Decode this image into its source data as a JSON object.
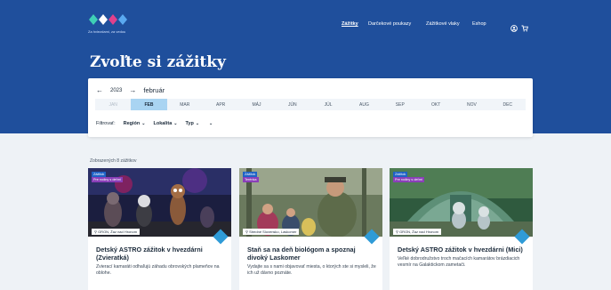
{
  "brand": {
    "tagline": "Za hviezdami, za vedou",
    "colors": {
      "dark_blue": "#1f4f9c",
      "diamond_blue": "#2f9bd7",
      "tag_blue": "#1f63c6",
      "tag_purple": "#8a3fb8",
      "selected_month": "#a9d4f2"
    }
  },
  "nav": {
    "items": [
      "Zážitky",
      "Darčekové poukazy",
      "Zážitkové vlaky",
      "Eshop"
    ],
    "active": "Zážitky",
    "icons": [
      "user-icon",
      "cart-icon"
    ]
  },
  "page": {
    "title": "Zvoľte si zážitky"
  },
  "filters": {
    "prev_arrow": "←",
    "year": "2023",
    "next_arrow": "→",
    "month_label": "február",
    "months": [
      "JAN",
      "FEB",
      "MAR",
      "APR",
      "MÁJ",
      "JÚN",
      "JÚL",
      "AUG",
      "SEP",
      "OKT",
      "NOV",
      "DEC"
    ],
    "selected_month": "FEB",
    "muted_months": [
      "JAN"
    ],
    "filter_label": "Filtrovať:",
    "dropdowns": [
      "Región",
      "Lokalita",
      "Typ",
      ""
    ]
  },
  "results": {
    "count_text": "Zobrazených 8 zážitkov",
    "cards": [
      {
        "category": "Zážitok",
        "tag": "Pre rodiny s deťmi",
        "location": "GRON, Žaz nad Hronom",
        "title": "Detský ASTRO zážitok v hvezdárni (Zvieratká)",
        "description": "Zvierací kamaráti odhaľujú záhadu obrovských plameňov na oblohe."
      },
      {
        "category": "Zážitok",
        "tag": "Terénka",
        "location": "Stredné Slovensko, Laskomer",
        "title": "Staň sa na deň biológom a spoznaj divoký Laskomer",
        "description": "Vydajte sa s nami objavovať miesta, o ktorých ste si mysleli, že ich už dávno poznáte."
      },
      {
        "category": "Zážitok",
        "tag": "Pre rodiny s deťmi",
        "location": "GRON, Žaz nad Hronom",
        "title": "Detský ASTRO zážitok v hvezdárni (Mici)",
        "description": "Veľké dobrodružstvo troch mačacích kamarátov brázdiacich vesmír na Galaktickom zametači."
      }
    ]
  }
}
